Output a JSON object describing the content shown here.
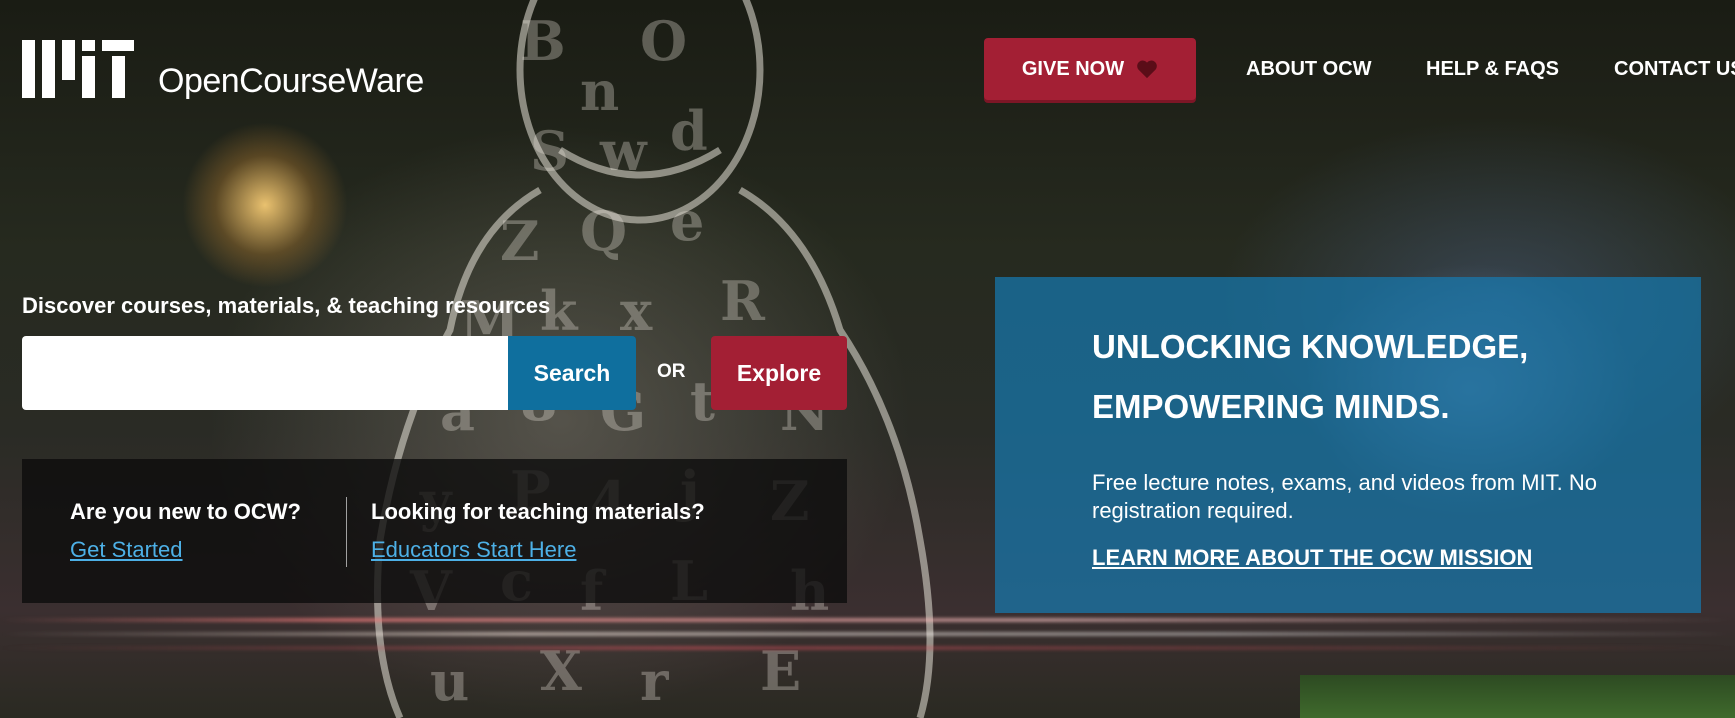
{
  "header": {
    "brand_name": "OpenCourseWare",
    "logo_icon": "mit-logo-icon",
    "give_button": {
      "label": "GIVE NOW",
      "icon": "heart-icon"
    },
    "nav": [
      {
        "label": "ABOUT OCW"
      },
      {
        "label": "HELP & FAQS"
      },
      {
        "label": "CONTACT US"
      }
    ]
  },
  "search": {
    "heading": "Discover courses, materials, & teaching resources",
    "input_value": "",
    "placeholder": "",
    "search_label": "Search",
    "or_label": "OR",
    "explore_label": "Explore"
  },
  "intro": {
    "new_question": "Are you new to OCW?",
    "new_link": "Get Started",
    "teach_question": "Looking for teaching materials?",
    "teach_link": "Educators Start Here"
  },
  "mission": {
    "title": "UNLOCKING KNOWLEDGE, EMPOWERING MINDS.",
    "subtitle": "Free lecture notes, exams, and videos from MIT. No registration required.",
    "link": "LEARN MORE ABOUT THE OCW MISSION"
  },
  "colors": {
    "mit_red": "#a31f34",
    "search_blue": "#0f6f9e",
    "mission_blue": "#1678af",
    "link_blue": "#4db0e6"
  }
}
